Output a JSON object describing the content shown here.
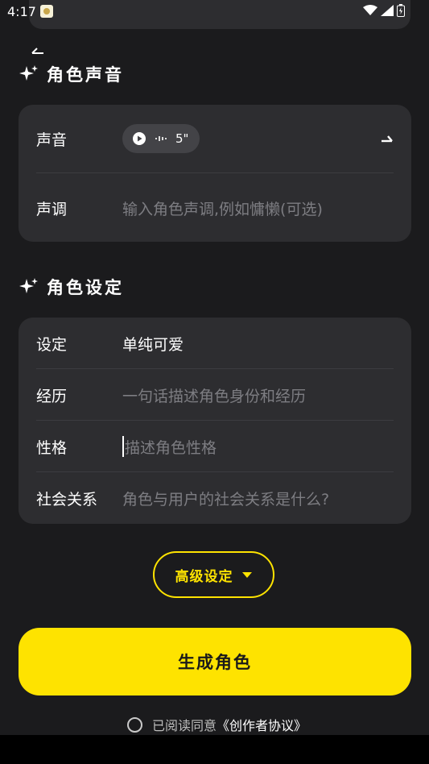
{
  "status_bar": {
    "time": "4:17"
  },
  "voice_section": {
    "title": "角色声音",
    "voice_label": "声音",
    "voice_duration": "5\"",
    "tone_label": "声调",
    "tone_placeholder": "输入角色声调,例如慵懒(可选)"
  },
  "setting_section": {
    "title": "角色设定",
    "rows": [
      {
        "label": "设定",
        "value": "单纯可爱",
        "placeholder": ""
      },
      {
        "label": "经历",
        "value": "",
        "placeholder": "一句话描述角色身份和经历"
      },
      {
        "label": "性格",
        "value": "",
        "placeholder": "描述角色性格"
      },
      {
        "label": "社会关系",
        "value": "",
        "placeholder": "角色与用户的社会关系是什么?"
      }
    ]
  },
  "advanced_button": {
    "label": "高级设定"
  },
  "generate_button": {
    "label": "生成角色"
  },
  "agreement": {
    "prefix": "已阅读同意",
    "link": "《创作者协议》",
    "checked": false
  },
  "colors": {
    "accent": "#fee300",
    "background": "#1b1b1d",
    "card": "#2d2d30"
  }
}
